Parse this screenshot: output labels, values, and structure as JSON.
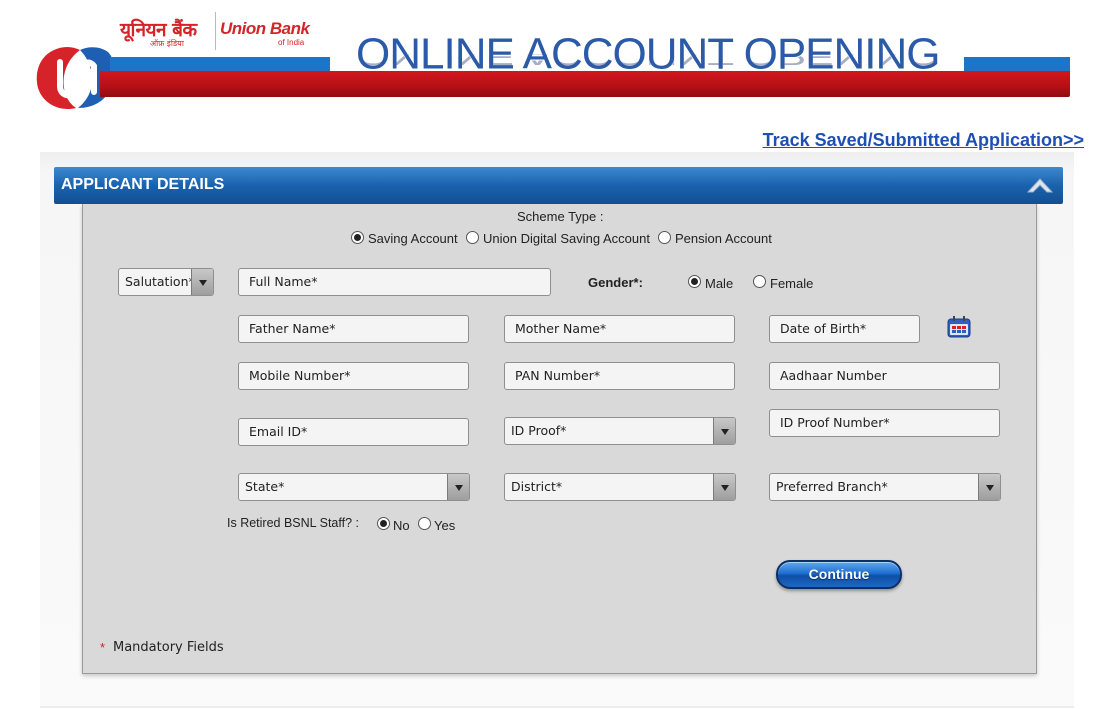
{
  "header": {
    "bank_name_hindi": "यूनियन बैंक",
    "bank_name_hindi_sub": "ऑफ़ इंडिया",
    "bank_name_english": "Union Bank",
    "bank_name_english_sub": "of India",
    "banner_title": "ONLINE ACCOUNT OPENING"
  },
  "track_link": "Track Saved/Submitted Application>>",
  "panel": {
    "title": "APPLICANT DETAILS"
  },
  "scheme": {
    "label": "Scheme Type :",
    "options": [
      "Saving Account",
      "Union Digital Saving Account",
      "Pension Account"
    ],
    "selected": "Saving Account"
  },
  "fields": {
    "salutation": "Salutation*",
    "full_name": "Full Name*",
    "gender_label": "Gender*:",
    "gender_male": "Male",
    "gender_female": "Female",
    "gender_selected": "Male",
    "father_name": "Father Name*",
    "mother_name": "Mother Name*",
    "dob": "Date of Birth*",
    "mobile": "Mobile Number*",
    "pan": "PAN Number*",
    "aadhaar": "Aadhaar Number",
    "email": "Email ID*",
    "id_proof": "ID Proof*",
    "id_proof_number": "ID Proof Number*",
    "state": "State*",
    "district": "District*",
    "branch": "Preferred Branch*"
  },
  "bsnl": {
    "label": "Is Retired BSNL Staff? :",
    "no": "No",
    "yes": "Yes",
    "selected": "No"
  },
  "continue_label": "Continue",
  "mandatory": {
    "star": "*",
    "text": "Mandatory Fields"
  },
  "colors": {
    "brand_red": "#d6232a",
    "brand_blue": "#1e75c6",
    "panel_header": "#1a62ae",
    "link": "#1d4fb5"
  }
}
